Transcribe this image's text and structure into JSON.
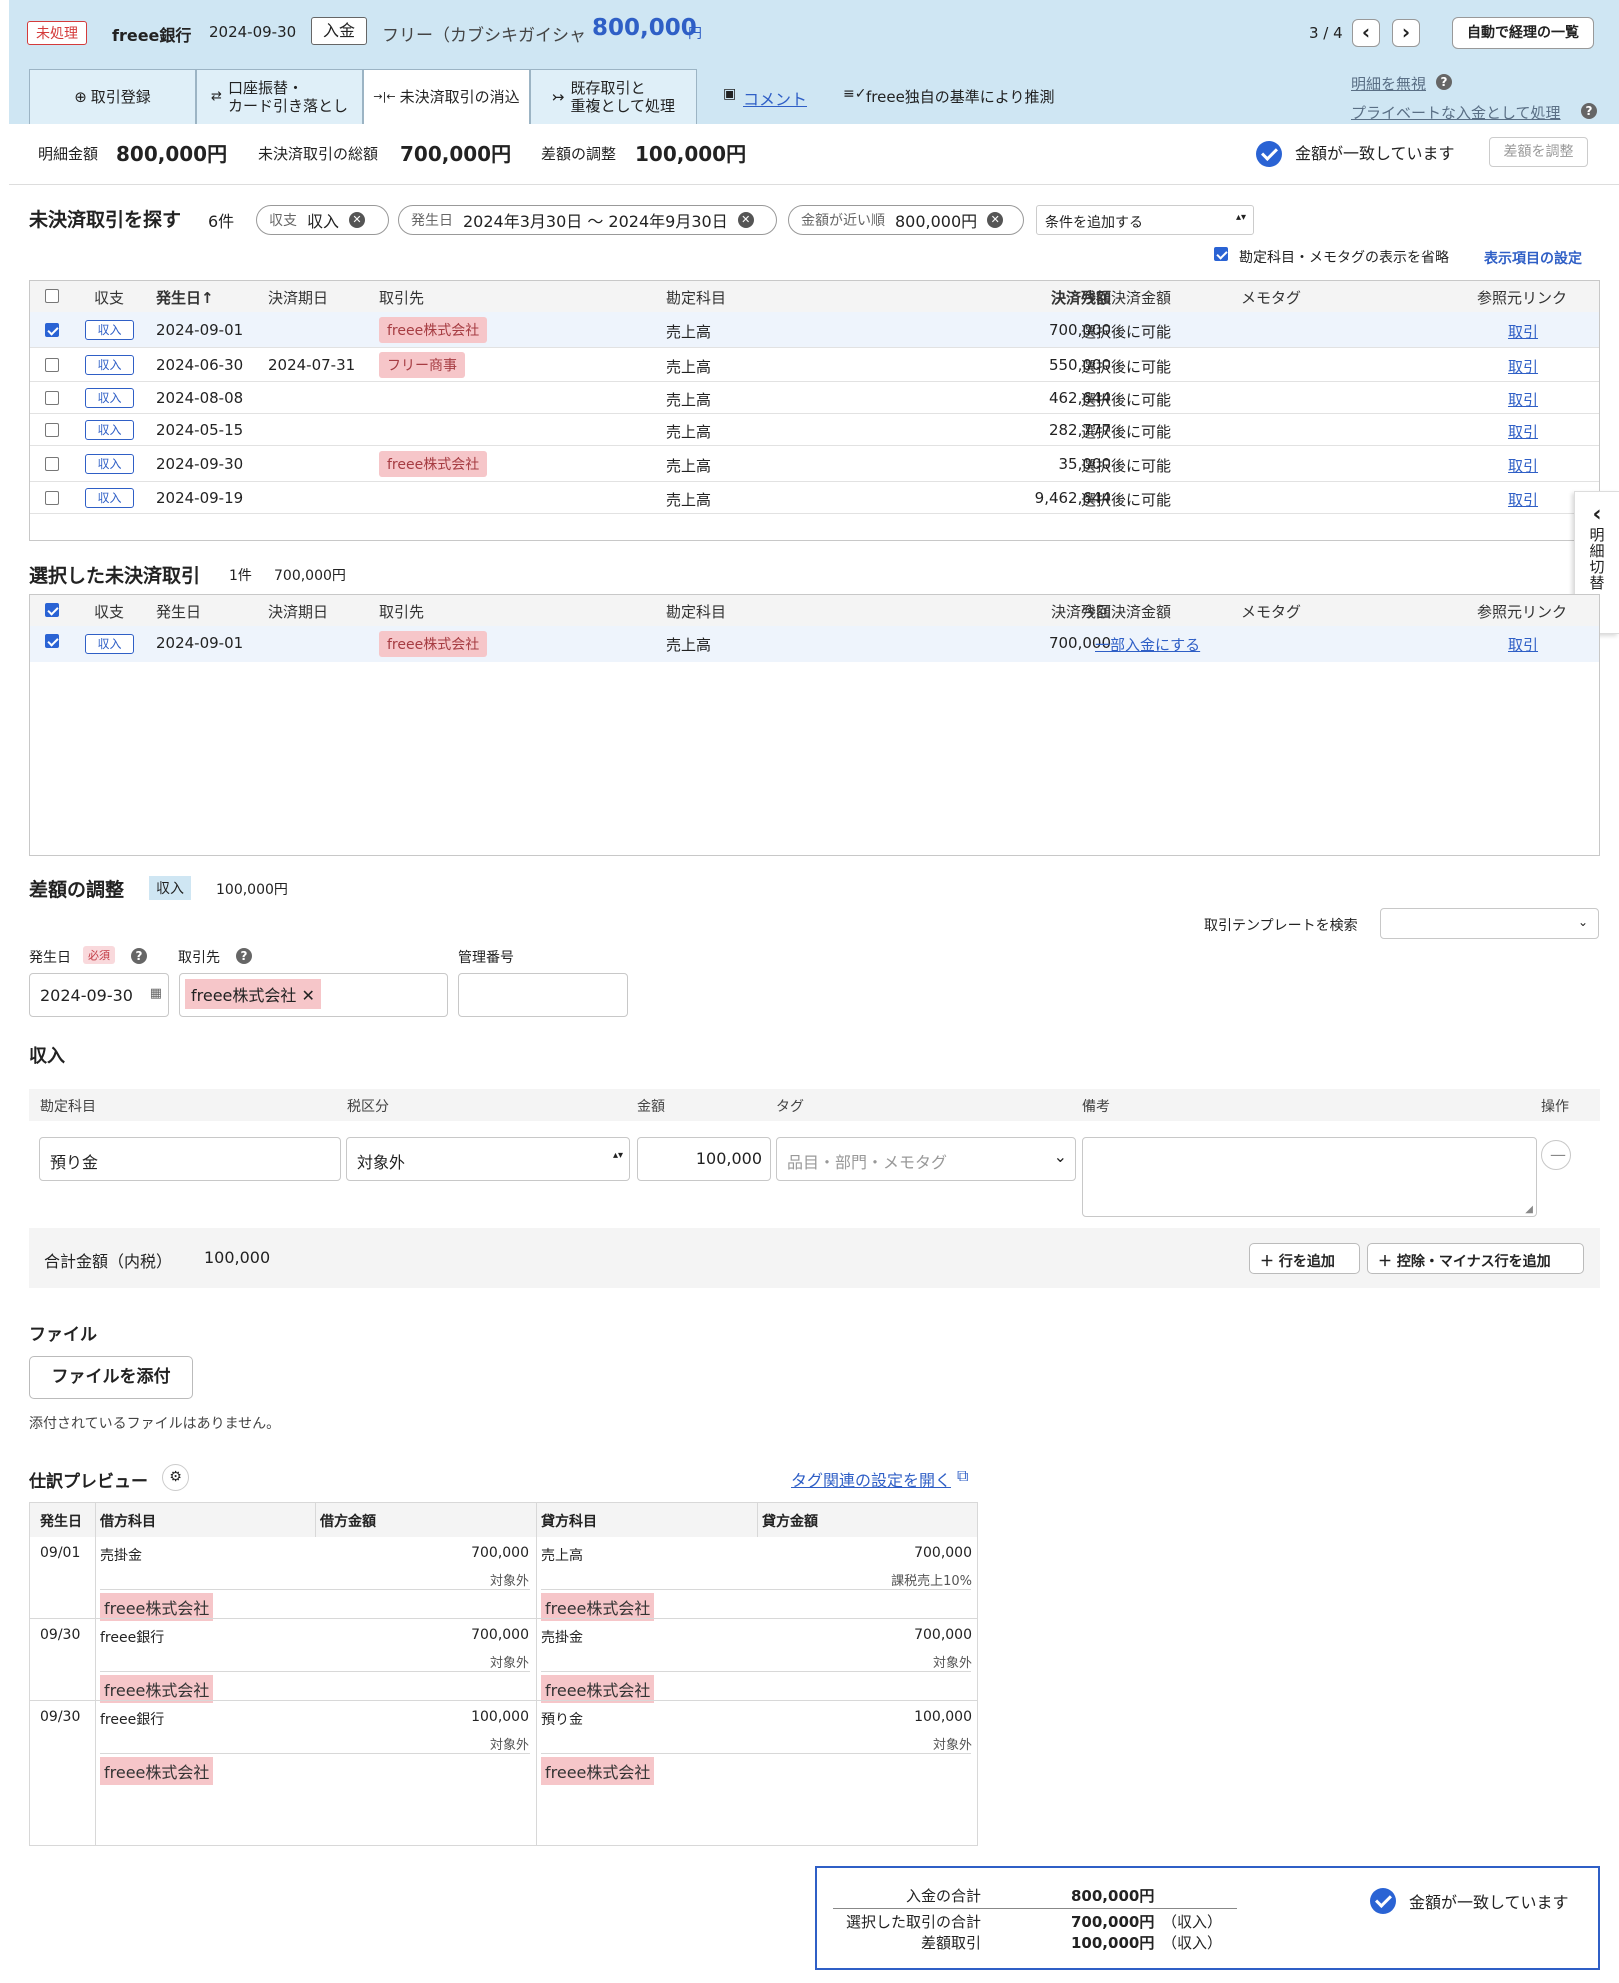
{
  "header": {
    "status": "未処理",
    "bank": "freee銀行",
    "date": "2024-09-30",
    "type": "入金",
    "payee": "フリー（カブシキガイシャ",
    "amount": "800,000",
    "yen": "円",
    "pager": "3 / 4",
    "prev": "‹",
    "next": "›",
    "list_button": "自動で経理の一覧"
  },
  "tabs": [
    {
      "icon": "⊕",
      "label": "取引登録"
    },
    {
      "icon": "⇄",
      "label": "口座振替・\nカード引き落とし"
    },
    {
      "icon": "→|←",
      "label": "未決済取引の消込"
    },
    {
      "icon": "↣",
      "label": "既存取引と\n重複として処理"
    }
  ],
  "links": {
    "comment": "コメント",
    "guess": "freee独自の基準により推測",
    "ignore": "明細を無視",
    "private": "プライベートな入金として処理"
  },
  "summary": {
    "detail_label": "明細金額",
    "detail_value": "800,000円",
    "total_label": "未決済取引の総額",
    "total_value": "700,000円",
    "diff_label": "差額の調整",
    "diff_value": "100,000円",
    "match": "金額が一致しています",
    "adjust_btn": "差額を調整"
  },
  "search": {
    "title": "未決済取引を探す",
    "count": "6件",
    "chips": [
      {
        "k": "収支",
        "v": "収入"
      },
      {
        "k": "発生日",
        "v": "2024年3月30日 〜 2024年9月30日"
      },
      {
        "k": "金額が近い順",
        "v": "800,000円"
      }
    ],
    "add_condition": "条件を追加する",
    "omit": "勘定科目・メモタグの表示を省略",
    "settings": "表示項目の設定"
  },
  "cols": {
    "kind": "収支",
    "date": "発生日",
    "settle_date": "決済期日",
    "partner": "取引先",
    "account": "勘定科目",
    "balance": "決済残額",
    "current": "今回決済金額",
    "memo": "メモタグ",
    "ref": "参照元リンク",
    "sort": "↑"
  },
  "rows": [
    {
      "kind": "収入",
      "date": "2024-09-01",
      "settle": "",
      "partner": "freee株式会社",
      "account": "売上高",
      "balance": "700,000",
      "current": "選択後に可能",
      "ref": "取引",
      "checked": true
    },
    {
      "kind": "収入",
      "date": "2024-06-30",
      "settle": "2024-07-31",
      "partner": "フリー商事",
      "account": "売上高",
      "balance": "550,000",
      "current": "選択後に可能",
      "ref": "取引",
      "checked": false
    },
    {
      "kind": "収入",
      "date": "2024-08-08",
      "settle": "",
      "partner": "",
      "account": "売上高",
      "balance": "462,644",
      "current": "選択後に可能",
      "ref": "取引",
      "checked": false
    },
    {
      "kind": "収入",
      "date": "2024-05-15",
      "settle": "",
      "partner": "",
      "account": "売上高",
      "balance": "282,777",
      "current": "選択後に可能",
      "ref": "取引",
      "checked": false
    },
    {
      "kind": "収入",
      "date": "2024-09-30",
      "settle": "",
      "partner": "freee株式会社",
      "account": "売上高",
      "balance": "35,000",
      "current": "選択後に可能",
      "ref": "取引",
      "checked": false
    },
    {
      "kind": "収入",
      "date": "2024-09-19",
      "settle": "",
      "partner": "",
      "account": "売上高",
      "balance": "9,462,644",
      "current": "選択後に可能",
      "ref": "取引",
      "checked": false
    }
  ],
  "side_tab": {
    "arrow": "‹",
    "label": "明細切替"
  },
  "selected": {
    "title": "選択した未決済取引",
    "count": "1件",
    "amount": "700,000円",
    "row": {
      "kind": "収入",
      "date": "2024-09-01",
      "partner": "freee株式会社",
      "account": "売上高",
      "balance": "700,000",
      "current": "一部入金にする",
      "ref": "取引"
    }
  },
  "adjust": {
    "title": "差額の調整",
    "kind": "収入",
    "amount": "100,000円",
    "template_label": "取引テンプレートを検索",
    "date_label": "発生日",
    "required": "必須",
    "partner_label": "取引先",
    "mgmt_label": "管理番号",
    "date_value": "2024-09-30",
    "partner_value": "freee株式会社"
  },
  "income": {
    "title": "収入",
    "cols": {
      "account": "勘定科目",
      "tax": "税区分",
      "amount": "金額",
      "tag": "タグ",
      "note": "備考",
      "op": "操作"
    },
    "account": "預り金",
    "tax": "対象外",
    "amount": "100,000",
    "tag_placeholder": "品目・部門・メモタグ",
    "total_label": "合計金額（内税）",
    "total": "100,000",
    "add_row": "行を追加",
    "add_minus": "控除・マイナス行を追加"
  },
  "file": {
    "title": "ファイル",
    "attach": "ファイルを添付",
    "none": "添付されているファイルはありません。"
  },
  "preview": {
    "title": "仕訳プレビュー",
    "tag_link": "タグ関連の設定を開く",
    "cols": {
      "date": "発生日",
      "debit": "借方科目",
      "debit_amt": "借方金額",
      "credit": "貸方科目",
      "credit_amt": "貸方金額"
    },
    "entries": [
      {
        "date": "09/01",
        "debit": "売掛金",
        "debit_amt": "700,000",
        "debit_tax": "対象外",
        "credit": "売上高",
        "credit_amt": "700,000",
        "credit_tax": "課税売上10%",
        "partner": "freee株式会社"
      },
      {
        "date": "09/30",
        "debit": "freee銀行",
        "debit_amt": "700,000",
        "debit_tax": "対象外",
        "credit": "売掛金",
        "credit_amt": "700,000",
        "credit_tax": "対象外",
        "partner": "freee株式会社"
      },
      {
        "date": "09/30",
        "debit": "freee銀行",
        "debit_amt": "100,000",
        "debit_tax": "対象外",
        "credit": "預り金",
        "credit_amt": "100,000",
        "credit_tax": "対象外",
        "partner": "freee株式会社"
      }
    ]
  },
  "footer": {
    "in_label": "入金の合計",
    "in_value": "800,000円",
    "sel_label": "選択した取引の合計",
    "sel_value": "700,000円",
    "sel_kind": "（収入）",
    "diff_label": "差額取引",
    "diff_value": "100,000円",
    "diff_kind": "（収入）",
    "match": "金額が一致しています"
  }
}
